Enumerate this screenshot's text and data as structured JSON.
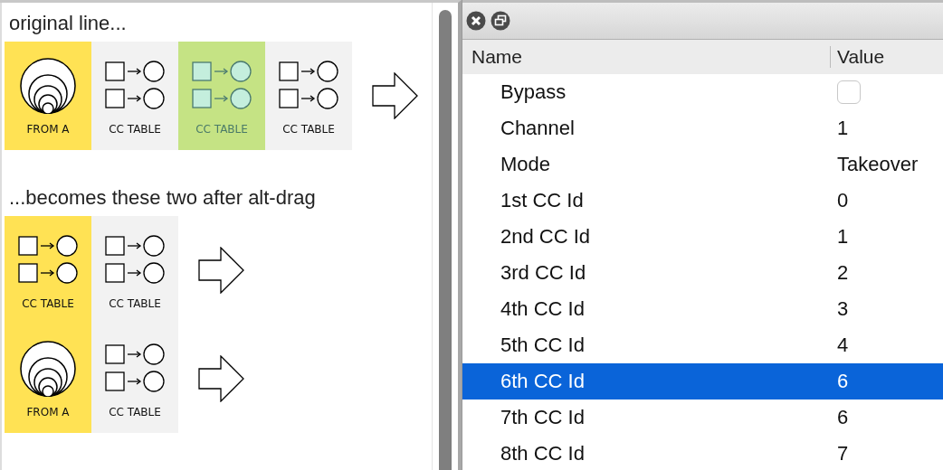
{
  "diagram": {
    "sections": [
      {
        "heading": "original line...",
        "groups": [
          {
            "tiles": [
              {
                "kind": "source",
                "label": "FROM A",
                "color": "#ffe254",
                "selected": false
              },
              {
                "kind": "table",
                "label": "CC TABLE",
                "color": "#f2f2f2",
                "selected": false
              },
              {
                "kind": "table",
                "label": "CC TABLE",
                "color": "#c5e384",
                "selected": true
              },
              {
                "kind": "table",
                "label": "CC TABLE",
                "color": "#f2f2f2",
                "selected": false
              }
            ]
          }
        ]
      },
      {
        "heading": "...becomes these two after alt-drag",
        "groups": [
          {
            "tiles": [
              {
                "kind": "table",
                "label": "CC TABLE",
                "color": "#ffe254",
                "selected": false
              },
              {
                "kind": "table",
                "label": "CC TABLE",
                "color": "#f2f2f2",
                "selected": false
              }
            ]
          },
          {
            "tiles": [
              {
                "kind": "source",
                "label": "FROM A",
                "color": "#ffe254",
                "selected": false
              },
              {
                "kind": "table",
                "label": "CC TABLE",
                "color": "#f2f2f2",
                "selected": false
              }
            ]
          }
        ]
      }
    ]
  },
  "properties": {
    "columns": [
      "Name",
      "Value"
    ],
    "rows": [
      {
        "name": "Bypass",
        "kind": "checkbox",
        "checked": false,
        "selected": false
      },
      {
        "name": "Channel",
        "value": "1",
        "kind": "text",
        "selected": false
      },
      {
        "name": "Mode",
        "value": "Takeover",
        "kind": "text",
        "selected": false
      },
      {
        "name": "1st CC Id",
        "value": "0",
        "kind": "text",
        "selected": false
      },
      {
        "name": "2nd CC Id",
        "value": "1",
        "kind": "text",
        "selected": false
      },
      {
        "name": "3rd CC Id",
        "value": "2",
        "kind": "text",
        "selected": false
      },
      {
        "name": "4th CC Id",
        "value": "3",
        "kind": "text",
        "selected": false
      },
      {
        "name": "5th CC Id",
        "value": "4",
        "kind": "text",
        "selected": false
      },
      {
        "name": "6th CC Id",
        "value": "6",
        "kind": "text",
        "selected": true
      },
      {
        "name": "7th CC Id",
        "value": "6",
        "kind": "text",
        "selected": false
      },
      {
        "name": "8th CC Id",
        "value": "7",
        "kind": "text",
        "selected": false
      }
    ]
  }
}
